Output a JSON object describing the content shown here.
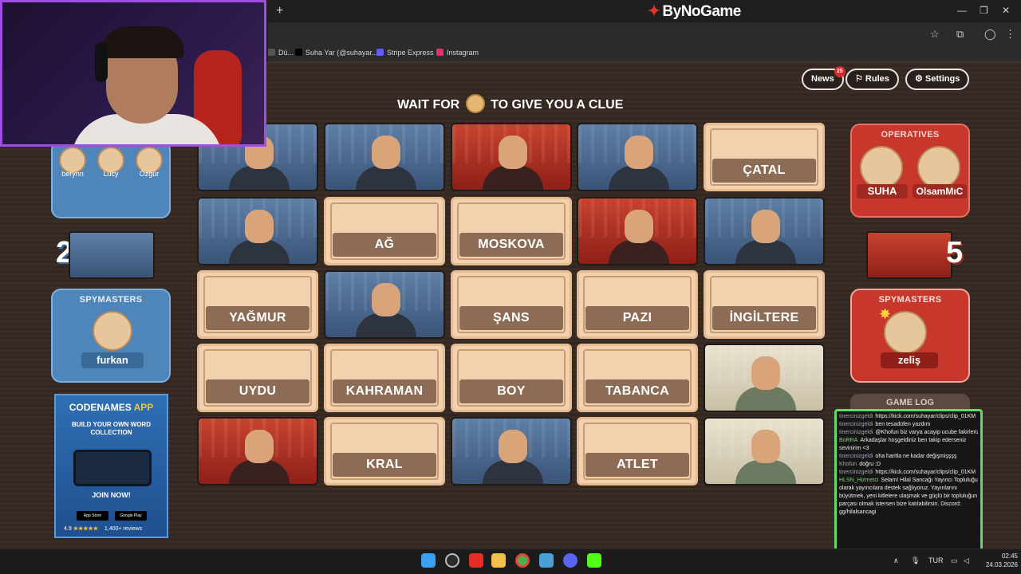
{
  "browser": {
    "brand": "ByNoGame",
    "new_tab": "+",
    "bookmarks": [
      {
        "label": "Dü...",
        "color": "#555555"
      },
      {
        "label": "Suha Yar (@suhayar....",
        "color": "#000000"
      },
      {
        "label": "Stripe Express",
        "color": "#635bff"
      },
      {
        "label": "Instagram",
        "color": "#e1306c"
      }
    ]
  },
  "header": {
    "news_label": "News",
    "news_badge": "25",
    "rules_label": "Rules",
    "settings_label": "Settings",
    "clue_prefix": "WAIT FOR",
    "clue_suffix": "TO GIVE YOU A CLUE",
    "clue_avatar_name": "zeliş"
  },
  "board": {
    "cards": [
      {
        "type": "agent",
        "color": "blue"
      },
      {
        "type": "agent",
        "color": "blue"
      },
      {
        "type": "agent",
        "color": "red"
      },
      {
        "type": "agent",
        "color": "blue"
      },
      {
        "type": "word",
        "word": "ÇATAL"
      },
      {
        "type": "agent",
        "color": "blue"
      },
      {
        "type": "word",
        "word": "AĞ"
      },
      {
        "type": "word",
        "word": "MOSKOVA"
      },
      {
        "type": "agent",
        "color": "red"
      },
      {
        "type": "agent",
        "color": "blue"
      },
      {
        "type": "word",
        "word": "YAĞMUR"
      },
      {
        "type": "agent",
        "color": "blue"
      },
      {
        "type": "word",
        "word": "ŞANS"
      },
      {
        "type": "word",
        "word": "PAZI"
      },
      {
        "type": "word",
        "word": "İNGİLTERE"
      },
      {
        "type": "word",
        "word": "UYDU"
      },
      {
        "type": "word",
        "word": "KAHRAMAN"
      },
      {
        "type": "word",
        "word": "BOY"
      },
      {
        "type": "word",
        "word": "TABANCA"
      },
      {
        "type": "agent",
        "color": "beige"
      },
      {
        "type": "agent",
        "color": "red"
      },
      {
        "type": "word",
        "word": "KRAL"
      },
      {
        "type": "agent",
        "color": "blue"
      },
      {
        "type": "word",
        "word": "ATLET"
      },
      {
        "type": "agent",
        "color": "beige"
      }
    ]
  },
  "blue_team": {
    "operatives": [
      "berynn",
      "Lucy",
      "Özgür"
    ],
    "remaining": "2",
    "spymasters_title": "SPYMASTERS",
    "spymaster": "furkan",
    "color": "#4f86b9"
  },
  "red_team": {
    "operatives_title": "OPERATIVES",
    "operatives": [
      "SUHA",
      "OlsamMıC"
    ],
    "remaining": "5",
    "spymasters_title": "SPYMASTERS",
    "spymaster": "zeliş",
    "color": "#c8372c"
  },
  "ad": {
    "title": "CODENAMES",
    "title_accent": "APP",
    "subtitle": "BUILD YOUR OWN WORD COLLECTION",
    "cta": "JOIN NOW!",
    "app_store": "App Store",
    "google_play": "Google Play",
    "rating": "4.9",
    "stars": "★★★★★",
    "reviews": "1,400+ reviews"
  },
  "game_log": {
    "title": "GAME LOG"
  },
  "chat": [
    {
      "user": "tinercinizgeldi",
      "msg": "https://kick.com/suhayar/clips/clip_01KM",
      "green": false,
      "indent": false
    },
    {
      "user": "tinercinizgeldi",
      "msg": "ben tesadüfen yazdım",
      "green": false,
      "indent": false
    },
    {
      "user": "tinercinizgeldi",
      "msg": "@Khofun biz varya acayip ucube fakirleriz",
      "green": false,
      "indent": false
    },
    {
      "user": "BoRRA",
      "msg": "Arkadaşlar hoşgeldiniz ben takip ederseniz sevinirim <3",
      "green": true,
      "indent": false
    },
    {
      "user": "tinercinizgeldi",
      "msg": "oha haritla ne kadar değişmişşşş",
      "green": false,
      "indent": false
    },
    {
      "user": "Khofun",
      "msg": "doğru :D",
      "green": false,
      "indent": false
    },
    {
      "user": "tinercinizgeldi",
      "msg": "https://kick.com/suhayar/clips/clip_01KM",
      "green": false,
      "indent": false
    },
    {
      "user": "HLSN_Hizmetci",
      "msg": "Selam! Hilal Sancağı Yayıncı Topluluğu olarak yayıncılara destek sağlıyoruz. Yayınlarını büyütmek, yeni kitlelere ulaşmak ve güçlü bir topluluğun parçası olmak istersen bize katılabilirsin. Discord: gg/hilalsancagi",
      "green": true,
      "indent": false
    }
  ],
  "taskbar": {
    "language": "TUR",
    "time": "02:45",
    "date": "24.03.2026"
  }
}
